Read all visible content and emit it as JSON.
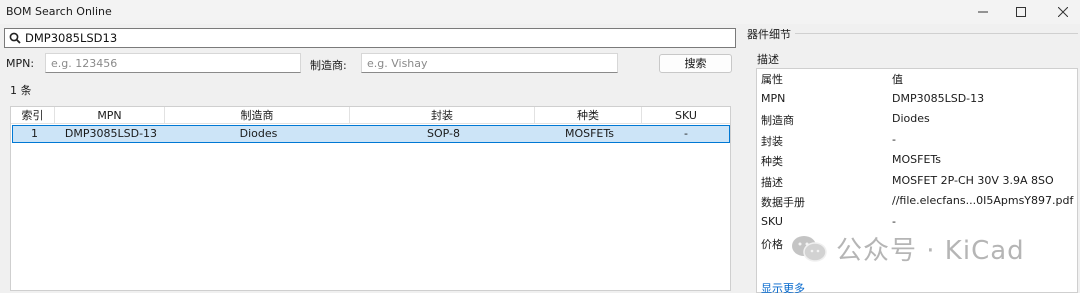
{
  "window": {
    "title": "BOM Search Online"
  },
  "search": {
    "query": "DMP3085LSD13"
  },
  "filters": {
    "mpn_label": "MPN:",
    "mpn_placeholder": "e.g. 123456",
    "manufacturer_label": "制造商:",
    "manufacturer_placeholder": "e.g. Vishay",
    "search_button": "搜索"
  },
  "results": {
    "count_label": "1 条",
    "columns": [
      "索引",
      "MPN",
      "制造商",
      "封装",
      "种类",
      "SKU"
    ],
    "rows": [
      [
        "1",
        "DMP3085LSD-13",
        "Diodes",
        "SOP-8",
        "MOSFETs",
        "-"
      ]
    ]
  },
  "details": {
    "group_title": "器件细节",
    "description_label": "描述",
    "header": {
      "key": "属性",
      "value": "值"
    },
    "properties": [
      {
        "key": "MPN",
        "value": "DMP3085LSD-13"
      },
      {
        "key": "制造商",
        "value": "Diodes"
      },
      {
        "key": "封装",
        "value": "-"
      },
      {
        "key": "种类",
        "value": "MOSFETs"
      },
      {
        "key": "描述",
        "value": "MOSFET 2P-CH 30V 3.9A 8SO"
      },
      {
        "key": "数据手册",
        "value": "//file.elecfans...0I5ApmsY897.pdf"
      },
      {
        "key": "SKU",
        "value": "-"
      },
      {
        "key": "价格",
        "value": ""
      }
    ],
    "show_more": "显示更多"
  },
  "watermark": {
    "text": "公众号 · KiCad"
  }
}
